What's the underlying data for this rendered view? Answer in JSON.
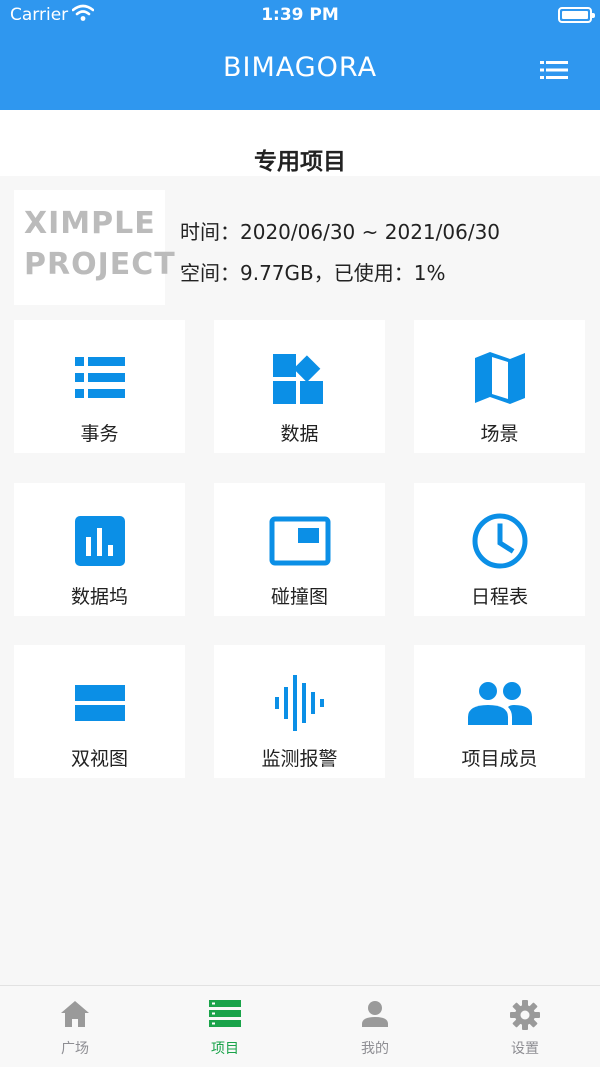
{
  "status_bar": {
    "carrier": "Carrier",
    "time": "1:39 PM"
  },
  "header": {
    "title": "BIMAGORA",
    "menu_icon": "list-icon"
  },
  "section": {
    "title": "专用项目"
  },
  "project": {
    "logo_line1": "XIMPLE",
    "logo_line2": "PROJECT",
    "time_line": "时间：2020/06/30 ~ 2021/06/30",
    "space_line": "空间：9.77GB，已使用：1%"
  },
  "colors": {
    "brand": "#2f97ef",
    "icon": "#0b8fe6",
    "tab_active": "#1aa34a",
    "tab_inactive": "#9a9a9a"
  },
  "tiles": [
    {
      "label": "事务",
      "icon": "list-icon"
    },
    {
      "label": "数据",
      "icon": "widgets-icon"
    },
    {
      "label": "场景",
      "icon": "map-icon"
    },
    {
      "label": "数据坞",
      "icon": "bar-chart-icon"
    },
    {
      "label": "碰撞图",
      "icon": "picture-in-picture-icon"
    },
    {
      "label": "日程表",
      "icon": "clock-icon"
    },
    {
      "label": "双视图",
      "icon": "split-view-icon"
    },
    {
      "label": "监测报警",
      "icon": "waveform-icon"
    },
    {
      "label": "项目成员",
      "icon": "people-icon"
    }
  ],
  "tabbar": {
    "tabs": [
      {
        "label": "广场",
        "icon": "home-icon",
        "active": false
      },
      {
        "label": "项目",
        "icon": "storage-icon",
        "active": true
      },
      {
        "label": "我的",
        "icon": "person-icon",
        "active": false
      },
      {
        "label": "设置",
        "icon": "gear-icon",
        "active": false
      }
    ]
  }
}
